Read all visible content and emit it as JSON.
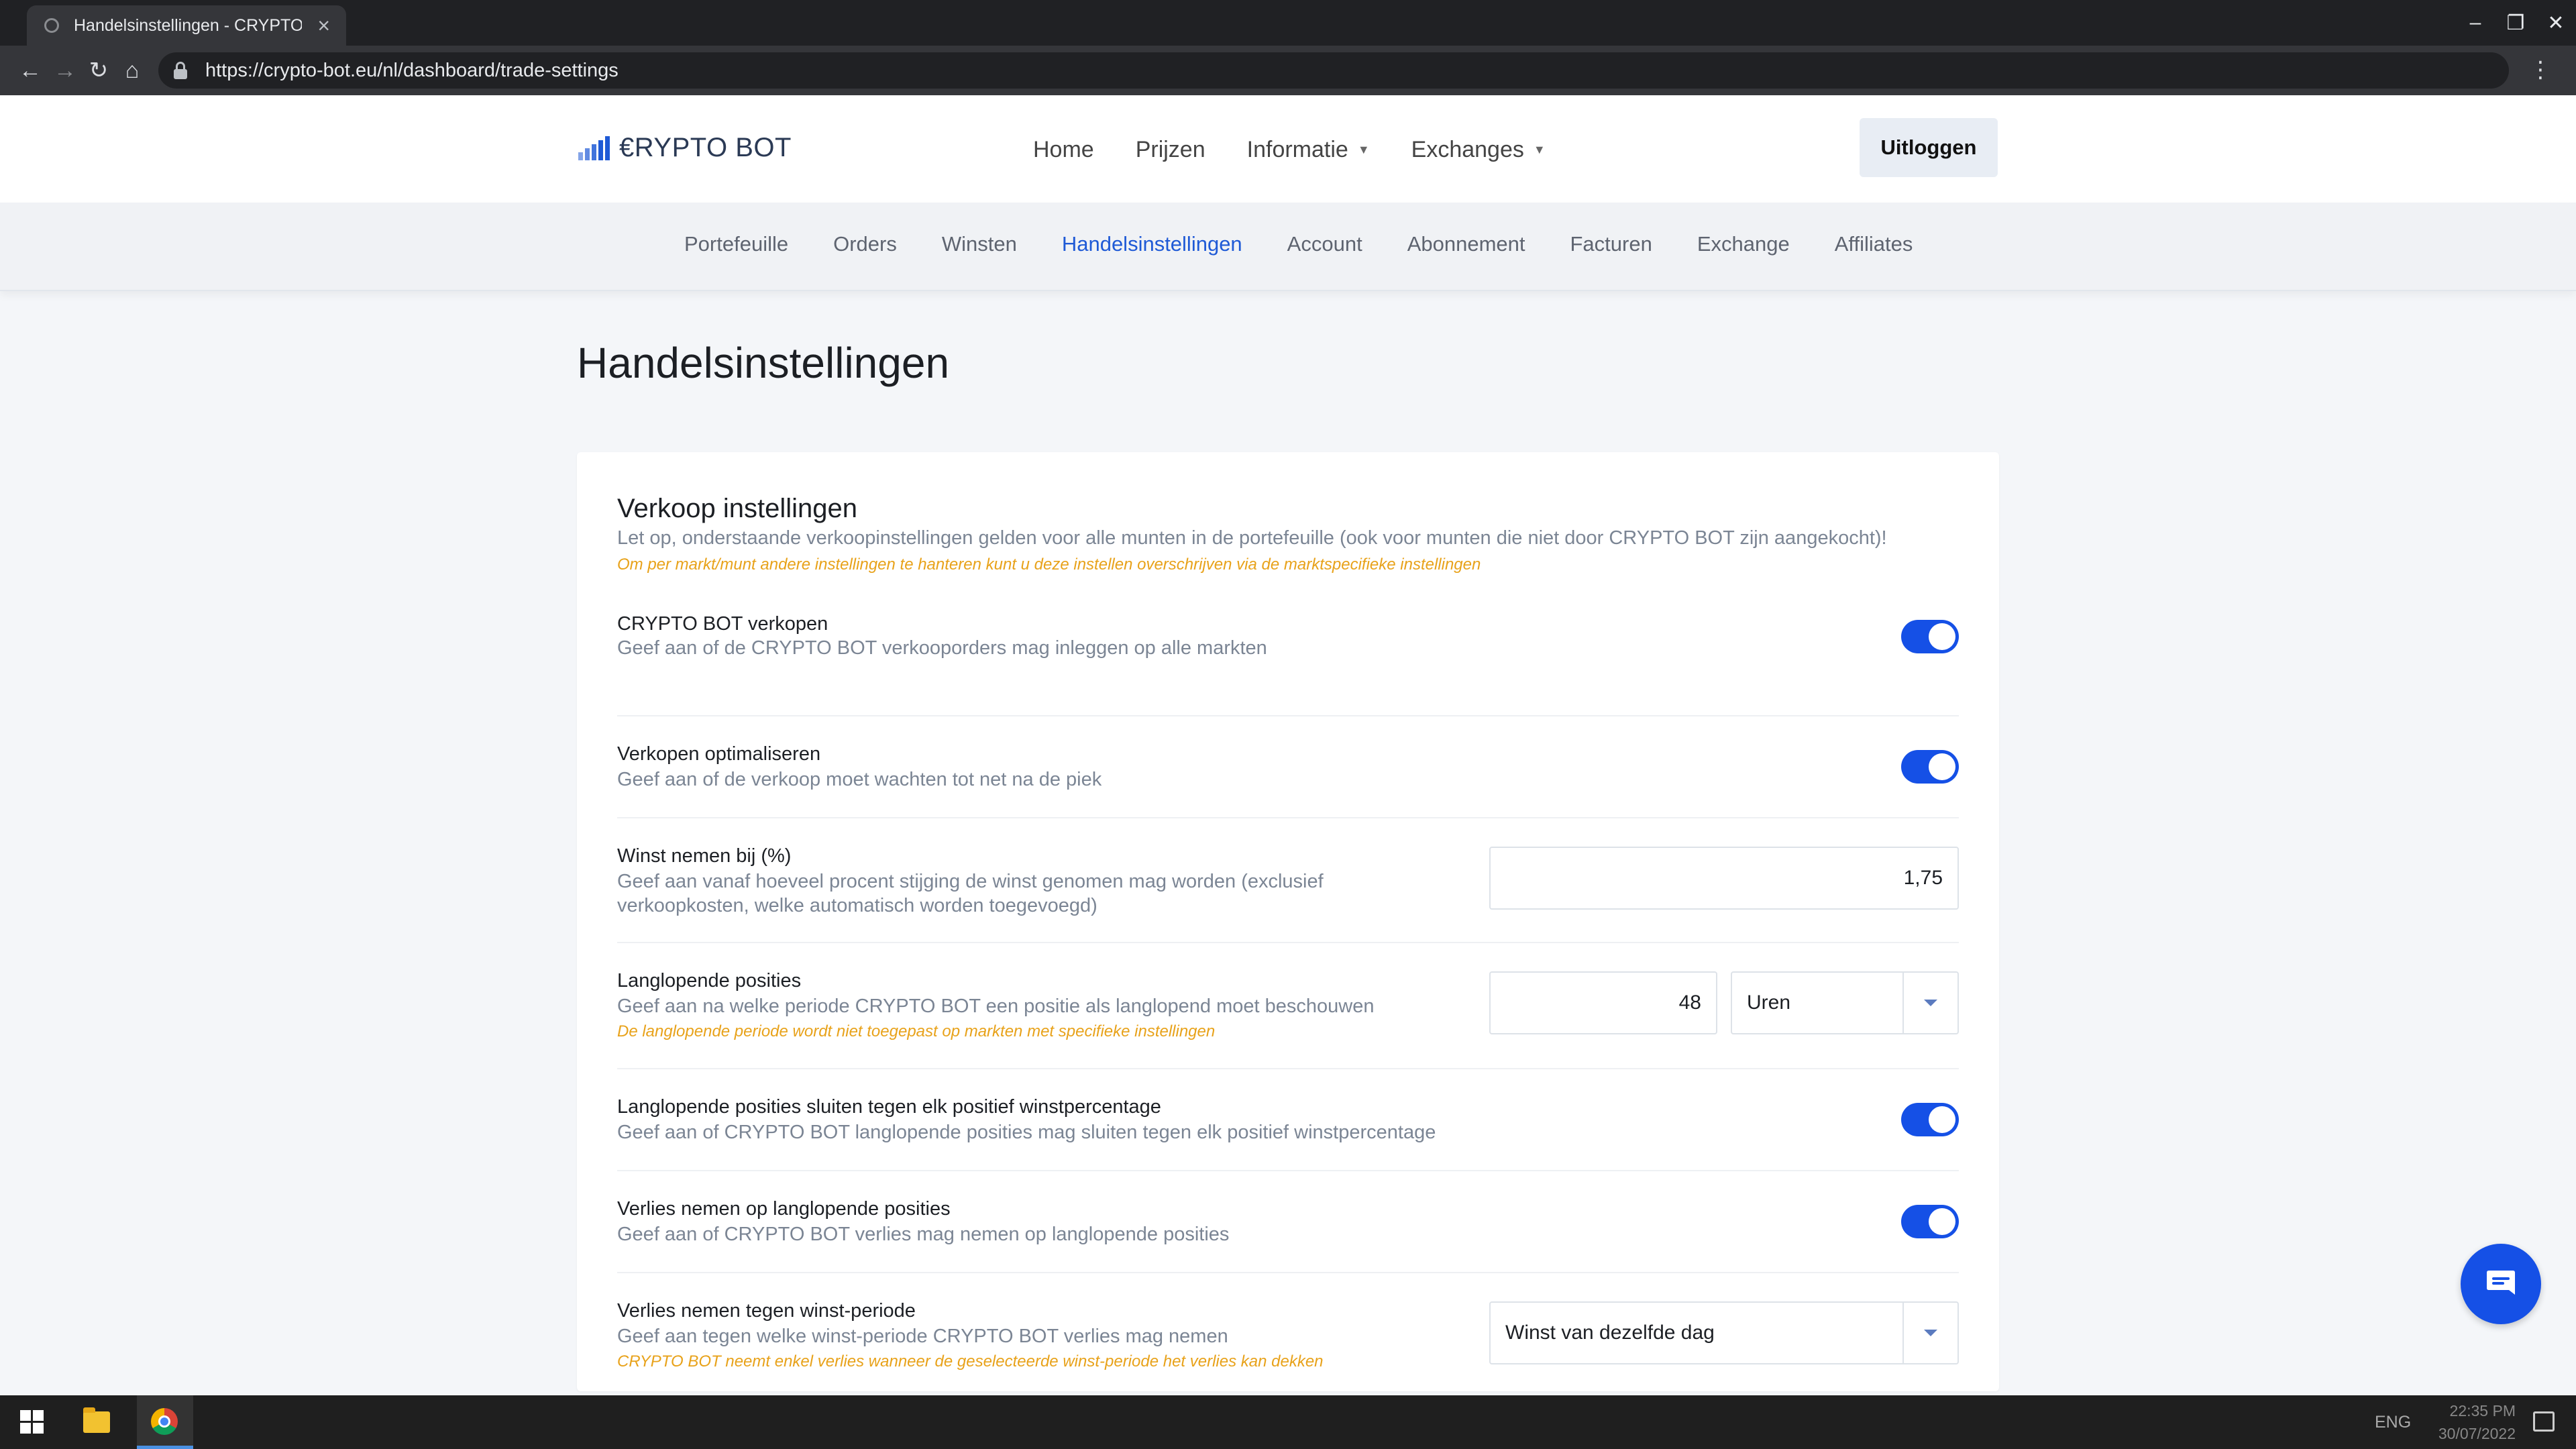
{
  "browser": {
    "tab_title": "Handelsinstellingen - CRYPTO",
    "url": "https://crypto-bot.eu/nl/dashboard/trade-settings"
  },
  "header": {
    "logo_text": "€RYPTO BOT",
    "nav": [
      {
        "label": "Home",
        "has_dropdown": false
      },
      {
        "label": "Prijzen",
        "has_dropdown": false
      },
      {
        "label": "Informatie",
        "has_dropdown": true
      },
      {
        "label": "Exchanges",
        "has_dropdown": true
      }
    ],
    "logout_label": "Uitloggen"
  },
  "subnav": {
    "items": [
      "Portefeuille",
      "Orders",
      "Winsten",
      "Handelsinstellingen",
      "Account",
      "Abonnement",
      "Facturen",
      "Exchange",
      "Affiliates"
    ],
    "active": "Handelsinstellingen"
  },
  "page": {
    "title": "Handelsinstellingen"
  },
  "sell_settings": {
    "title": "Verkoop instellingen",
    "description": "Let op, onderstaande verkoopinstellingen gelden voor alle munten in de portefeuille (ook voor munten die niet door CRYPTO BOT zijn aangekocht)!",
    "note": "Om per markt/munt andere instellingen te hanteren kunt u deze instellen overschrijven via de marktspecifieke instellingen",
    "rows": [
      {
        "label": "CRYPTO BOT verkopen",
        "help": "Geef aan of de CRYPTO BOT verkooporders mag inleggen op alle markten",
        "toggle": true
      },
      {
        "label": "Verkopen optimaliseren",
        "help": "Geef aan of de verkoop moet wachten tot net na de piek",
        "toggle": true
      },
      {
        "label": "Winst nemen bij (%)",
        "help_line1": "Geef aan vanaf hoeveel procent stijging de winst genomen mag worden (exclusief",
        "help_line2": "verkoopkosten, welke automatisch worden toegevoegd)",
        "value": "1,75"
      },
      {
        "label": "Langlopende posities",
        "help": "Geef aan na welke periode CRYPTO BOT een positie als langlopend moet beschouwen",
        "note": "De langlopende periode wordt niet toegepast op markten met specifieke instellingen",
        "value": "48",
        "unit": "Uren"
      },
      {
        "label": "Langlopende posities sluiten tegen elk positief winstpercentage",
        "help": "Geef aan of CRYPTO BOT langlopende posities mag sluiten tegen elk positief winstpercentage",
        "toggle": true
      },
      {
        "label": "Verlies nemen op langlopende posities",
        "help": "Geef aan of CRYPTO BOT verlies mag nemen op langlopende posities",
        "toggle": true
      },
      {
        "label": "Verlies nemen tegen winst-periode",
        "help": "Geef aan tegen welke winst-periode CRYPTO BOT verlies mag nemen",
        "note": "CRYPTO BOT neemt enkel verlies wanneer de geselecteerde winst-periode het verlies kan dekken",
        "value": "Winst van dezelfde dag"
      }
    ]
  },
  "taskbar": {
    "lang": "ENG",
    "time": "22:35 PM",
    "date": "30/07/2022"
  },
  "colors": {
    "accent": "#1550e6",
    "note": "#e8a21a",
    "help_text": "#7b8594"
  }
}
